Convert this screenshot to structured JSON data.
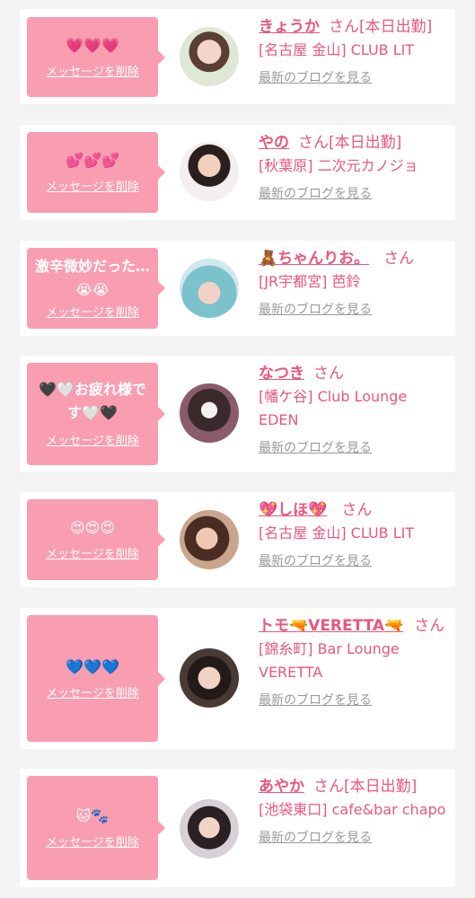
{
  "cards": [
    {
      "message": "💗💗💗",
      "delete_label": "メッセージを削除",
      "name": "きょうか",
      "san": "さん",
      "status": "[本日出勤]",
      "shop": "[名古屋 金山] CLUB LIT",
      "blog_label": "最新のブログを見る"
    },
    {
      "message": "💕💕💕",
      "delete_label": "メッセージを削除",
      "name": "やの",
      "san": "さん",
      "status": "[本日出勤]",
      "shop": "[秋葉原] 二次元カノジョ",
      "blog_label": "最新のブログを見る"
    },
    {
      "message": "激辛微妙だった… 😭😭",
      "delete_label": "メッセージを削除",
      "name": "🧸ちゃんりお。",
      "san": "さん",
      "status": "",
      "shop": "[JR宇都宮] 芭鈴",
      "blog_label": "最新のブログを見る"
    },
    {
      "message": "🖤🤍お疲れ様です🤍🖤",
      "delete_label": "メッセージを削除",
      "name": "なつき",
      "san": "さん",
      "status": "",
      "shop": "[幡ケ谷] Club Lounge EDEN",
      "blog_label": "最新のブログを見る"
    },
    {
      "message": "😍😍😍",
      "delete_label": "メッセージを削除",
      "name": "💖しほ💖",
      "san": "さん",
      "status": "",
      "shop": "[名古屋 金山] CLUB LIT",
      "blog_label": "最新のブログを見る"
    },
    {
      "message": "💙💙💙",
      "delete_label": "メッセージを削除",
      "name": "トモ🔫VERETTA🔫",
      "san": "さん",
      "status": "",
      "shop": "[錦糸町] Bar Lounge VERETTA",
      "blog_label": "最新のブログを見る"
    },
    {
      "message": "🐱🐾",
      "delete_label": "メッセージを削除",
      "name": "あやか",
      "san": "さん",
      "status": "[本日出勤]",
      "shop": "[池袋東口] cafe&bar chapo",
      "blog_label": "最新のブログを見る"
    }
  ]
}
